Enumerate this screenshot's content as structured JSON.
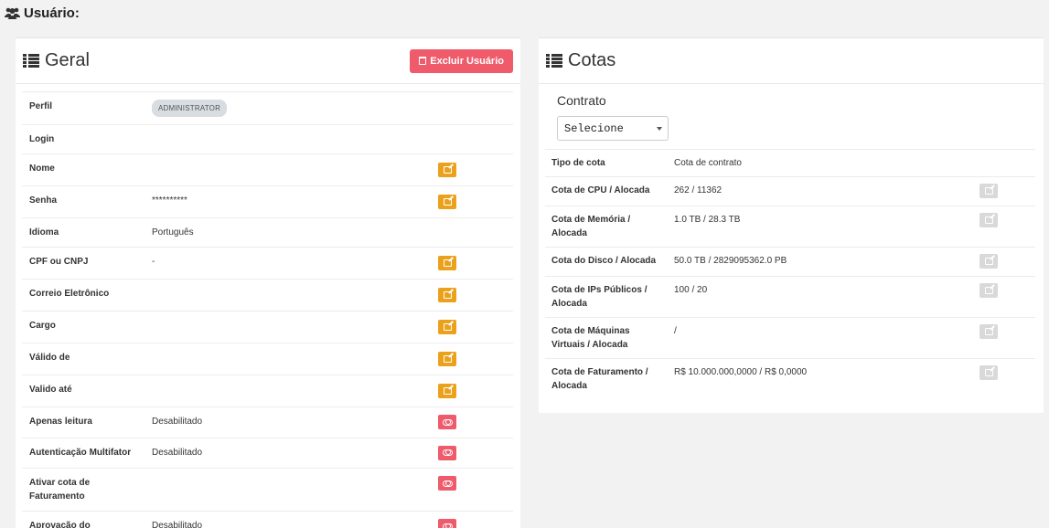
{
  "page": {
    "title": "Usuário:",
    "header_icon": "users-icon"
  },
  "general": {
    "title": "Geral",
    "delete_button": "Excluir Usuário",
    "rows": [
      {
        "label": "Perfil",
        "value": "ADMINISTRATOR",
        "action": "none",
        "value_type": "badge"
      },
      {
        "label": "Login",
        "value": "",
        "action": "none"
      },
      {
        "label": "Nome",
        "value": "",
        "action": "edit"
      },
      {
        "label": "Senha",
        "value": "**********",
        "action": "edit"
      },
      {
        "label": "Idioma",
        "value": "Português",
        "action": "none"
      },
      {
        "label": "CPF ou CNPJ",
        "value": "-",
        "action": "edit"
      },
      {
        "label": "Correio Eletrônico",
        "value": "",
        "action": "edit"
      },
      {
        "label": "Cargo",
        "value": "",
        "action": "edit"
      },
      {
        "label": "Válido de",
        "value": "",
        "action": "edit"
      },
      {
        "label": "Valido até",
        "value": "",
        "action": "edit"
      },
      {
        "label": "Apenas leitura",
        "value": "Desabilitado",
        "action": "toggle"
      },
      {
        "label": "Autenticação Multifator",
        "value": "Desabilitado",
        "action": "toggle"
      },
      {
        "label": "Ativar cota de Faturamento",
        "value": "",
        "action": "toggle"
      },
      {
        "label": "Aprovação do administrador",
        "value": "Desabilitado",
        "action": "toggle"
      }
    ]
  },
  "quotas": {
    "title": "Cotas",
    "contract_label": "Contrato",
    "contract_select_value": "Selecione",
    "rows": [
      {
        "label": "Tipo de cota",
        "value": "Cota de contrato",
        "action": "none"
      },
      {
        "label": "Cota de CPU / Alocada",
        "value": "262 / 11362",
        "action": "edit-disabled"
      },
      {
        "label": "Cota de Memória / Alocada",
        "value": "1.0 TB / 28.3 TB",
        "action": "edit-disabled"
      },
      {
        "label": "Cota do Disco / Alocada",
        "value": "50.0 TB / 2829095362.0 PB",
        "action": "edit-disabled"
      },
      {
        "label": "Cota de IPs Públicos / Alocada",
        "value": "100 / 20",
        "action": "edit-disabled"
      },
      {
        "label": "Cota de Máquinas Virtuais / Alocada",
        "value": "/",
        "action": "edit-disabled"
      },
      {
        "label": "Cota de Faturamento / Alocada",
        "value": "R$ 10.000.000,0000 / R$ 0,0000",
        "action": "edit-disabled"
      }
    ]
  },
  "colors": {
    "edit": "#eba11c",
    "danger": "#ef5b6b",
    "disabled": "#d9d9d9",
    "background": "#f2f2f2"
  }
}
